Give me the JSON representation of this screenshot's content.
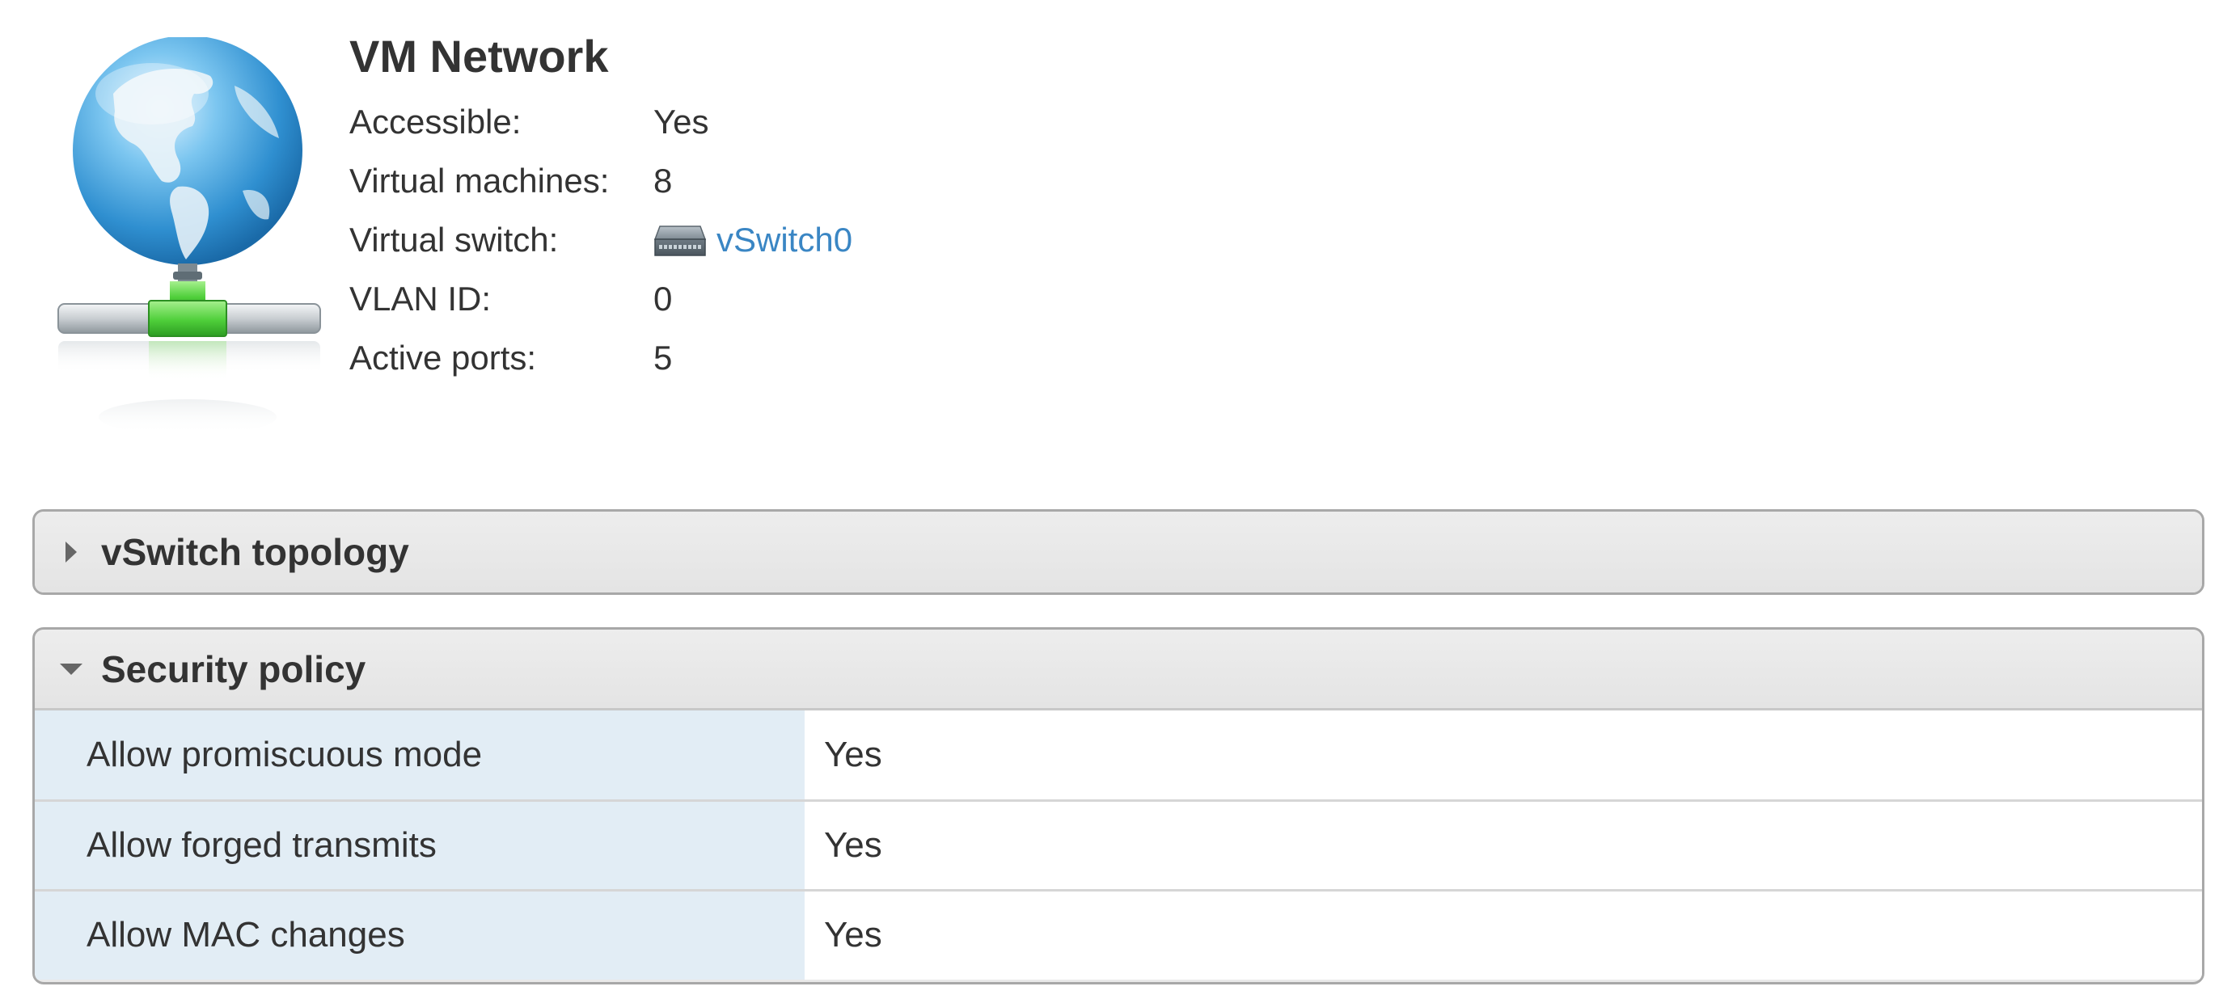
{
  "network": {
    "name": "VM Network",
    "icon": "globe-network-icon",
    "properties": [
      {
        "label": "Accessible:",
        "value": "Yes"
      },
      {
        "label": "Virtual machines:",
        "value": "8"
      },
      {
        "label": "Virtual switch:",
        "value": "vSwitch0",
        "icon": "vswitch-icon",
        "link": true
      },
      {
        "label": "VLAN ID:",
        "value": "0"
      },
      {
        "label": "Active ports:",
        "value": "5"
      }
    ]
  },
  "panels": {
    "topology": {
      "title": "vSwitch topology",
      "expanded": false
    },
    "security": {
      "title": "Security policy",
      "expanded": true,
      "rows": [
        {
          "name": "Allow promiscuous mode",
          "value": "Yes"
        },
        {
          "name": "Allow forged transmits",
          "value": "Yes"
        },
        {
          "name": "Allow MAC changes",
          "value": "Yes"
        }
      ]
    }
  },
  "colors": {
    "link": "#3a86c4",
    "label_column_bg": "#e2edf5",
    "panel_header_bg": "#e9e9e9",
    "text": "#333333"
  }
}
